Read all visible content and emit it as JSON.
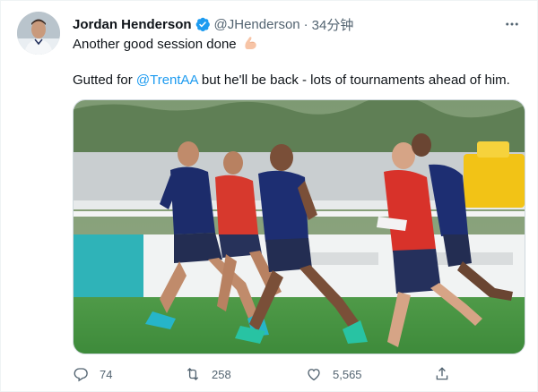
{
  "author": {
    "display_name": "Jordan Henderson",
    "handle": "@JHenderson",
    "separator": "·",
    "timestamp": "34分钟",
    "verified_icon": "verified-badge-icon"
  },
  "tweet": {
    "line1": "Another good session done",
    "line1_emoji": "flexed-biceps-emoji",
    "line2_prefix": "Gutted for ",
    "mention": "@TrentAA",
    "line2_suffix": " but he'll be back - lots of tournaments ahead of him."
  },
  "media": {
    "description_icon": "photo-england-training-run"
  },
  "actions": {
    "replies": "74",
    "retweets": "258",
    "likes": "5,565"
  },
  "more_icon": "more-options-icon",
  "colors": {
    "link": "#1d9bf0",
    "secondary_text": "#536471",
    "primary_text": "#0f1419"
  }
}
